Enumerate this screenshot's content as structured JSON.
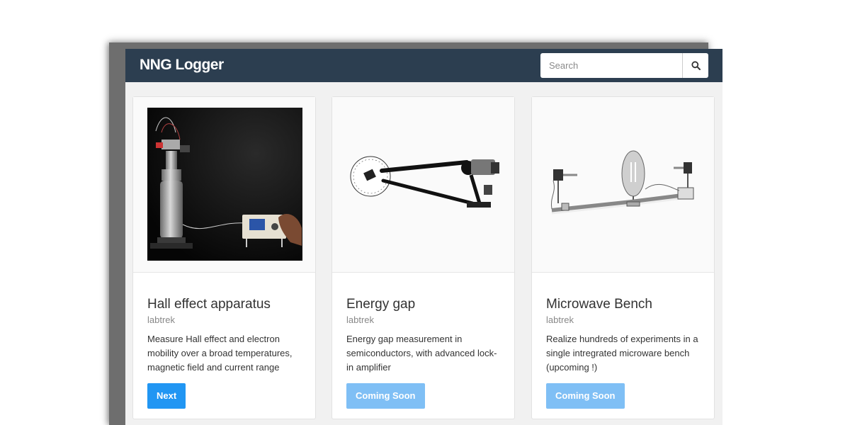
{
  "navbar": {
    "brand": "NNG Logger",
    "search_placeholder": "Search",
    "search_icon": "magnifier-icon"
  },
  "cards": [
    {
      "title": "Hall effect apparatus",
      "vendor": "labtrek",
      "description": "Measure Hall effect and electron mobility over a broad temperatures, magnetic field and current range",
      "button": "Next",
      "button_state": "enabled"
    },
    {
      "title": "Energy gap",
      "vendor": "labtrek",
      "description": "Energy gap measurement in semiconductors, with advanced lock-in amplifier",
      "button": "Coming Soon",
      "button_state": "disabled"
    },
    {
      "title": "Microwave Bench",
      "vendor": "labtrek",
      "description": "Realize hundreds of experiments in a single intregrated microware bench (upcoming !)",
      "button": "Coming Soon",
      "button_state": "disabled"
    }
  ],
  "colors": {
    "navbar": "#2c3e50",
    "primary": "#2196f3",
    "primary_muted": "#7fbff5",
    "page_bg": "#f1f1f1"
  }
}
